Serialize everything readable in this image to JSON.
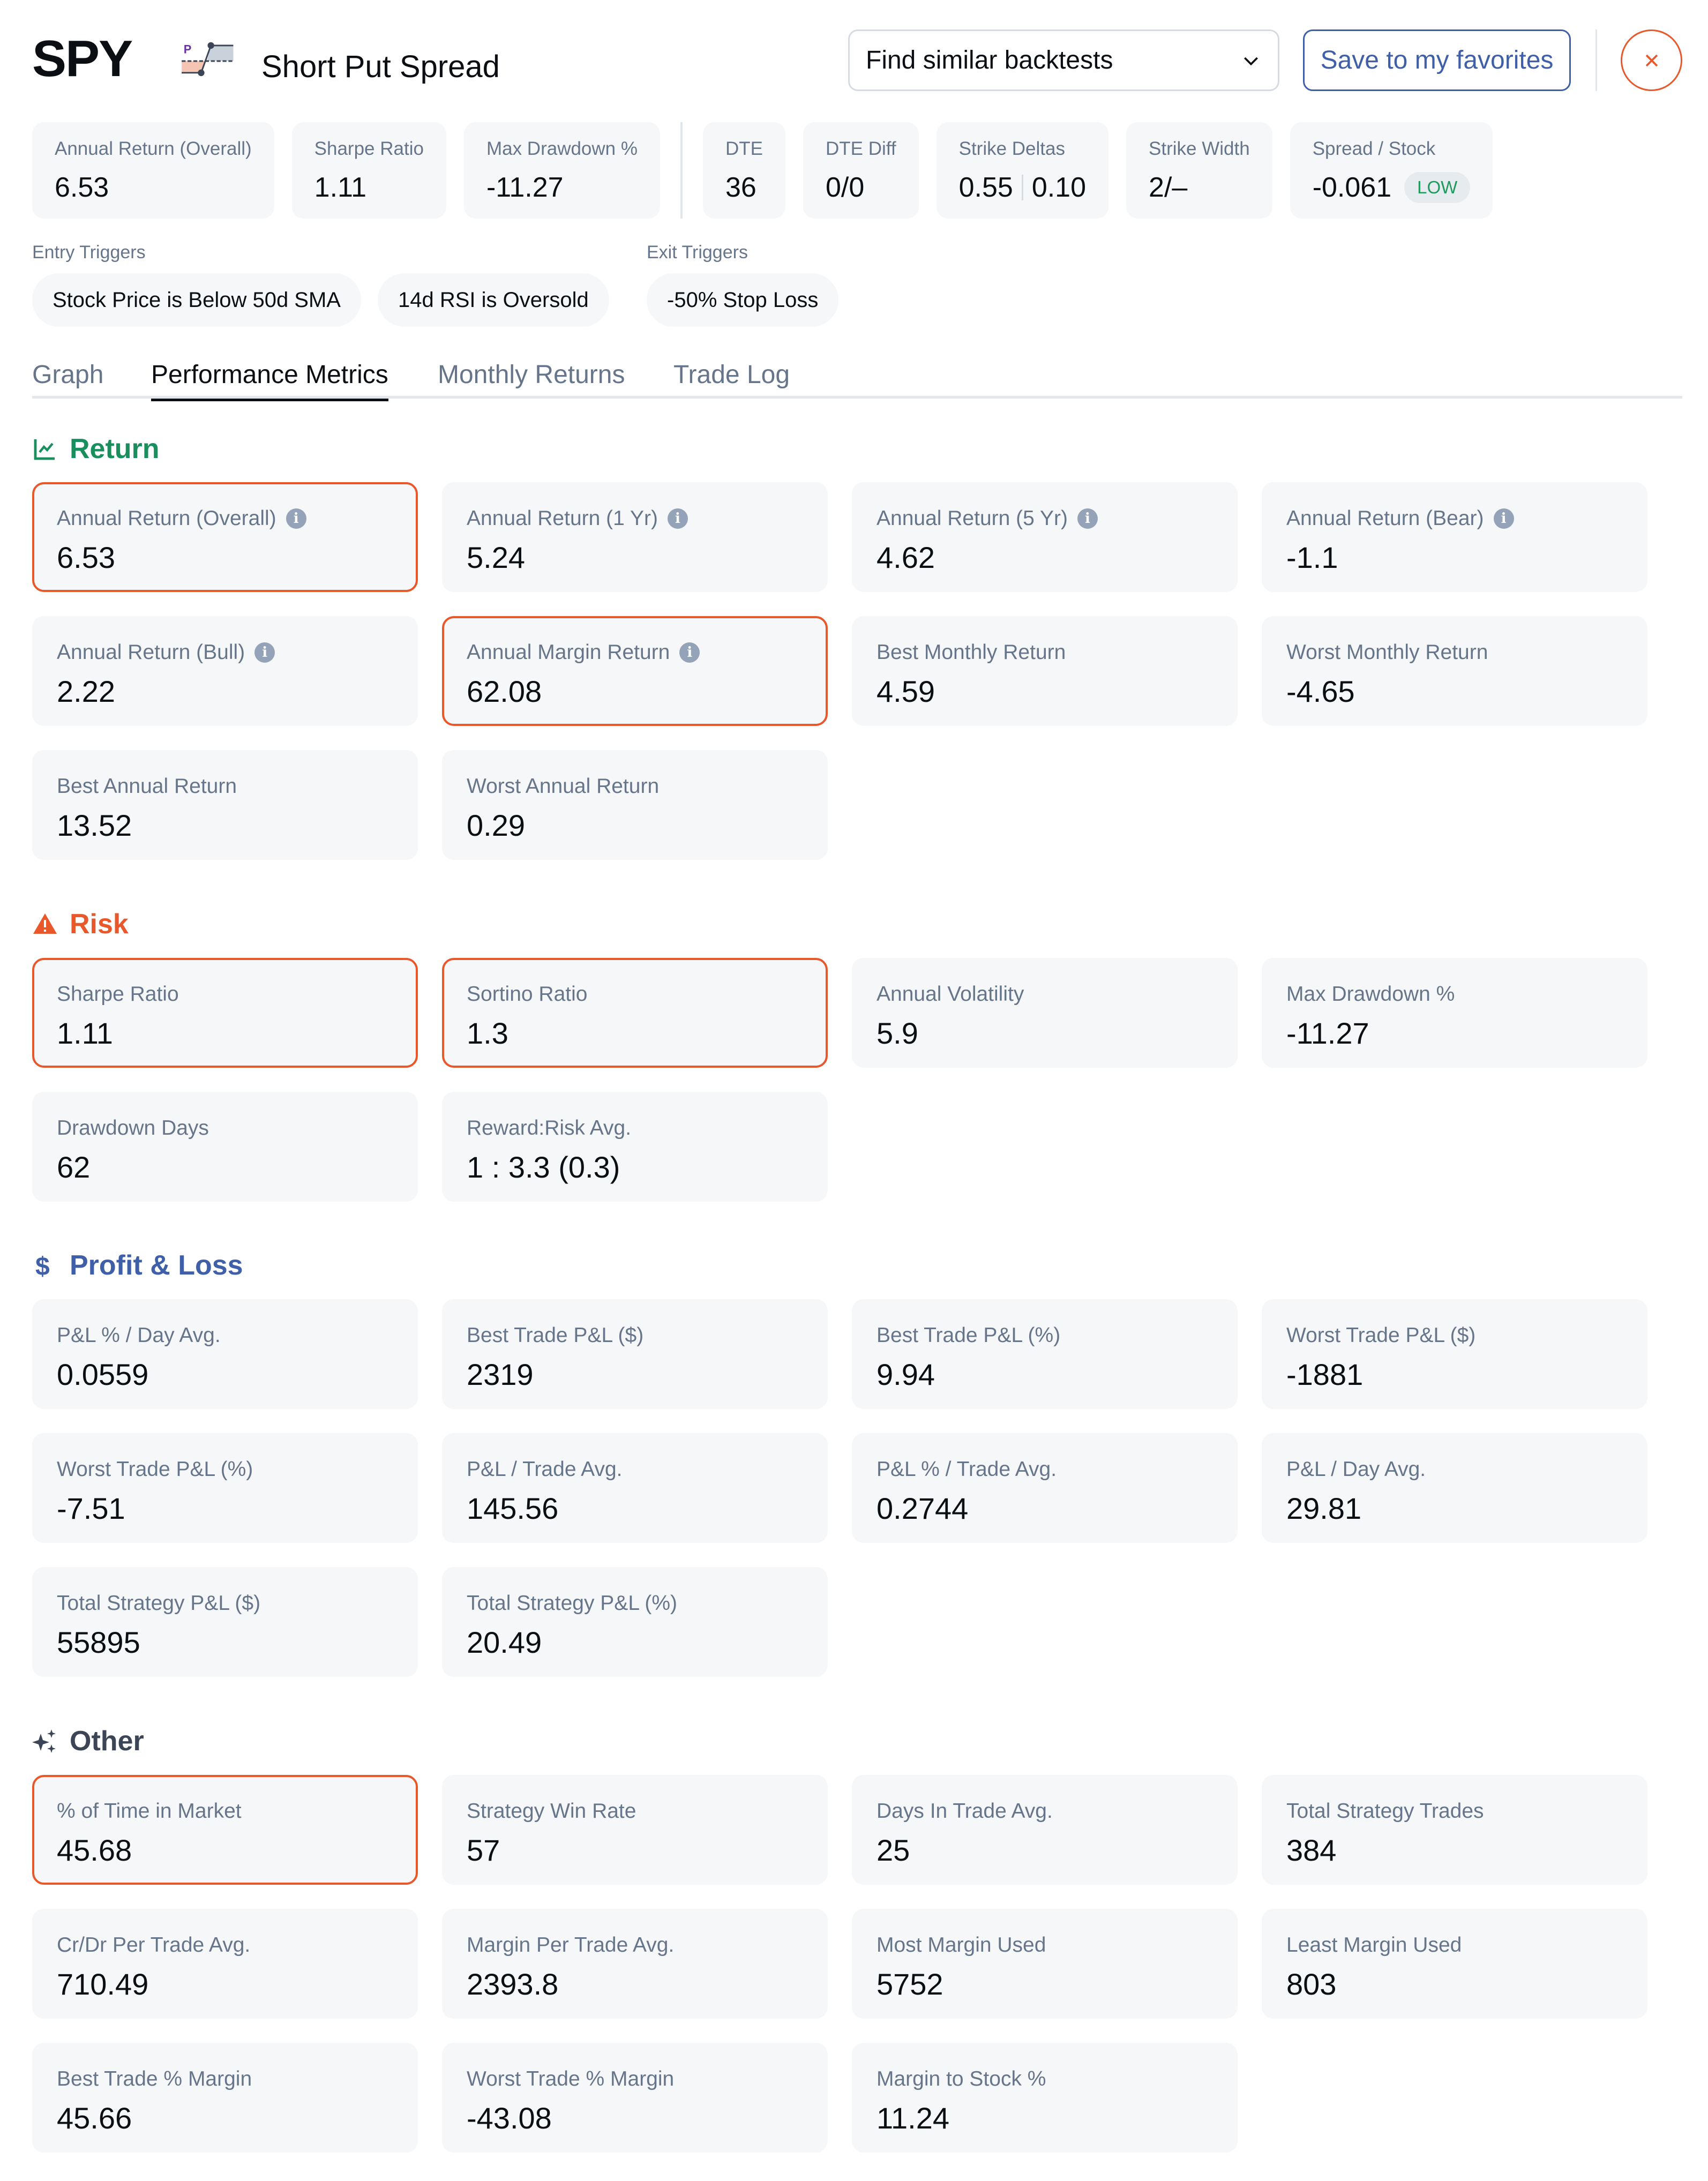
{
  "header": {
    "ticker": "SPY",
    "strategy_icon": "short-put-spread-payoff-icon",
    "strategy_icon_letter": "P",
    "strategy_name": "Short Put Spread",
    "find_similar_label": "Find similar backtests",
    "save_label": "Save to my favorites",
    "close_icon": "close-icon"
  },
  "summary": [
    {
      "label": "Annual Return (Overall)",
      "value": "6.53"
    },
    {
      "label": "Sharpe Ratio",
      "value": "1.11"
    },
    {
      "label": "Max Drawdown %",
      "value": "-11.27"
    },
    {
      "label": "DTE",
      "value": "36"
    },
    {
      "label": "DTE Diff",
      "value": "0/0"
    },
    {
      "label": "Strike Deltas",
      "value_a": "0.55",
      "value_b": "0.10"
    },
    {
      "label": "Strike Width",
      "value": "2/–"
    },
    {
      "label": "Spread / Stock",
      "value": "-0.061",
      "badge": "LOW"
    }
  ],
  "triggers": {
    "entry_label": "Entry Triggers",
    "entry": [
      "Stock Price is Below 50d SMA",
      "14d RSI is Oversold"
    ],
    "exit_label": "Exit Triggers",
    "exit": [
      "-50% Stop Loss"
    ]
  },
  "tabs": [
    {
      "label": "Graph",
      "active": false
    },
    {
      "label": "Performance Metrics",
      "active": true
    },
    {
      "label": "Monthly Returns",
      "active": false
    },
    {
      "label": "Trade Log",
      "active": false
    }
  ],
  "colors": {
    "return": "#1a8f5e",
    "risk": "#e8582a",
    "pnl": "#3f5fa8",
    "other": "#3b4556",
    "highlight_border": "#e8582a",
    "badge_low": "#1f9a5c"
  },
  "sections": {
    "return": {
      "title": "Return",
      "icon": "line-chart-icon",
      "cards": [
        {
          "label": "Annual Return (Overall)",
          "value": "6.53",
          "info": true,
          "highlight": true
        },
        {
          "label": "Annual Return (1 Yr)",
          "value": "5.24",
          "info": true,
          "highlight": false
        },
        {
          "label": "Annual Return (5 Yr)",
          "value": "4.62",
          "info": true,
          "highlight": false
        },
        {
          "label": "Annual Return (Bear)",
          "value": "-1.1",
          "info": true,
          "highlight": false
        },
        {
          "label": "Annual Return (Bull)",
          "value": "2.22",
          "info": true,
          "highlight": false
        },
        {
          "label": "Annual Margin Return",
          "value": "62.08",
          "info": true,
          "highlight": true
        },
        {
          "label": "Best Monthly Return",
          "value": "4.59",
          "info": false,
          "highlight": false
        },
        {
          "label": "Worst Monthly Return",
          "value": "-4.65",
          "info": false,
          "highlight": false
        },
        {
          "label": "Best Annual Return",
          "value": "13.52",
          "info": false,
          "highlight": false
        },
        {
          "label": "Worst Annual Return",
          "value": "0.29",
          "info": false,
          "highlight": false
        }
      ]
    },
    "risk": {
      "title": "Risk",
      "icon": "warning-triangle-icon",
      "cards": [
        {
          "label": "Sharpe Ratio",
          "value": "1.11",
          "info": false,
          "highlight": true
        },
        {
          "label": "Sortino Ratio",
          "value": "1.3",
          "info": false,
          "highlight": true
        },
        {
          "label": "Annual Volatility",
          "value": "5.9",
          "info": false,
          "highlight": false
        },
        {
          "label": "Max Drawdown %",
          "value": "-11.27",
          "info": false,
          "highlight": false
        },
        {
          "label": "Drawdown Days",
          "value": "62",
          "info": false,
          "highlight": false
        },
        {
          "label": "Reward:Risk Avg.",
          "value": "1 : 3.3 (0.3)",
          "info": false,
          "highlight": false
        }
      ]
    },
    "pnl": {
      "title": "Profit & Loss",
      "icon": "dollar-icon",
      "cards": [
        {
          "label": "P&L % / Day Avg.",
          "value": "0.0559",
          "info": false,
          "highlight": false
        },
        {
          "label": "Best Trade P&L ($)",
          "value": "2319",
          "info": false,
          "highlight": false
        },
        {
          "label": "Best Trade P&L (%)",
          "value": "9.94",
          "info": false,
          "highlight": false
        },
        {
          "label": "Worst Trade P&L ($)",
          "value": "-1881",
          "info": false,
          "highlight": false
        },
        {
          "label": "Worst Trade P&L (%)",
          "value": "-7.51",
          "info": false,
          "highlight": false
        },
        {
          "label": "P&L / Trade Avg.",
          "value": "145.56",
          "info": false,
          "highlight": false
        },
        {
          "label": "P&L % / Trade Avg.",
          "value": "0.2744",
          "info": false,
          "highlight": false
        },
        {
          "label": "P&L / Day Avg.",
          "value": "29.81",
          "info": false,
          "highlight": false
        },
        {
          "label": "Total Strategy P&L ($)",
          "value": "55895",
          "info": false,
          "highlight": false
        },
        {
          "label": "Total Strategy P&L (%)",
          "value": "20.49",
          "info": false,
          "highlight": false
        }
      ]
    },
    "other": {
      "title": "Other",
      "icon": "sparkles-icon",
      "cards": [
        {
          "label": "% of Time in Market",
          "value": "45.68",
          "info": false,
          "highlight": true
        },
        {
          "label": "Strategy Win Rate",
          "value": "57",
          "info": false,
          "highlight": false
        },
        {
          "label": "Days In Trade Avg.",
          "value": "25",
          "info": false,
          "highlight": false
        },
        {
          "label": "Total Strategy Trades",
          "value": "384",
          "info": false,
          "highlight": false
        },
        {
          "label": "Cr/Dr Per Trade Avg.",
          "value": "710.49",
          "info": false,
          "highlight": false
        },
        {
          "label": "Margin Per Trade Avg.",
          "value": "2393.8",
          "info": false,
          "highlight": false
        },
        {
          "label": "Most Margin Used",
          "value": "5752",
          "info": false,
          "highlight": false
        },
        {
          "label": "Least Margin Used",
          "value": "803",
          "info": false,
          "highlight": false
        },
        {
          "label": "Best Trade % Margin",
          "value": "45.66",
          "info": false,
          "highlight": false
        },
        {
          "label": "Worst Trade % Margin",
          "value": "-43.08",
          "info": false,
          "highlight": false
        },
        {
          "label": "Margin to Stock %",
          "value": "11.24",
          "info": false,
          "highlight": false
        }
      ]
    }
  },
  "info_icon_glyph": "i"
}
